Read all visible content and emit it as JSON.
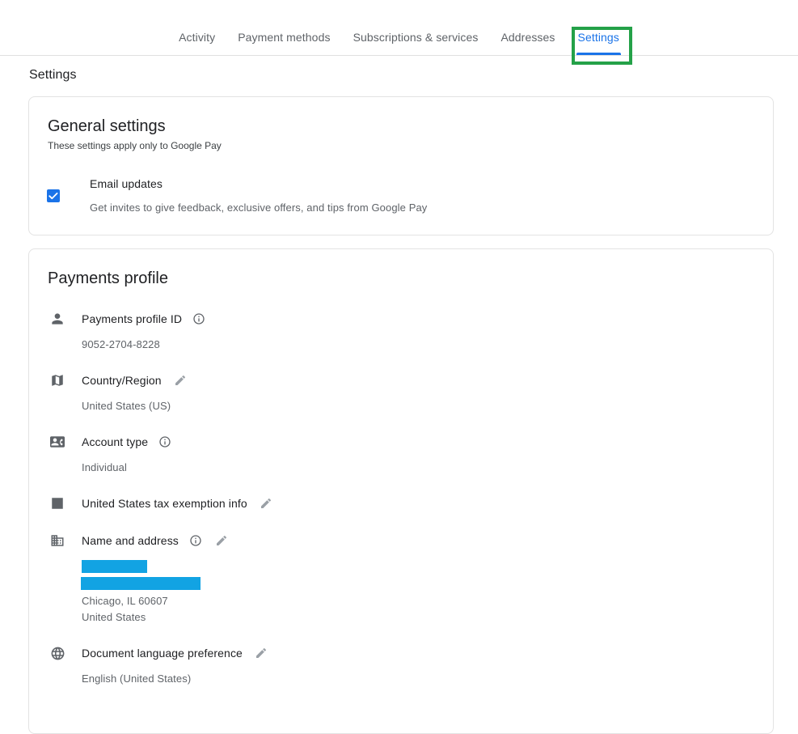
{
  "nav": {
    "tabs": [
      {
        "label": "Activity",
        "active": false
      },
      {
        "label": "Payment methods",
        "active": false
      },
      {
        "label": "Subscriptions & services",
        "active": false
      },
      {
        "label": "Addresses",
        "active": false
      },
      {
        "label": "Settings",
        "active": true
      }
    ],
    "highlight_color": "#24a148",
    "active_color": "#1a73e8"
  },
  "page": {
    "title": "Settings"
  },
  "general_settings": {
    "title": "General settings",
    "subtitle": "These settings apply only to Google Pay",
    "email_updates": {
      "label": "Email updates",
      "description": "Get invites to give feedback, exclusive offers, and tips from Google Pay",
      "checked": true,
      "checkbox_color": "#1a73e8"
    }
  },
  "payments_profile": {
    "title": "Payments profile",
    "rows": [
      {
        "icon": "person-icon",
        "label": "Payments profile ID",
        "info": true,
        "edit": false,
        "value": "9052-2704-8228"
      },
      {
        "icon": "map-icon",
        "label": "Country/Region",
        "info": false,
        "edit": true,
        "value": "United States (US)"
      },
      {
        "icon": "contact-card-icon",
        "label": "Account type",
        "info": true,
        "edit": false,
        "value": "Individual"
      },
      {
        "icon": "list-icon",
        "label": "United States tax exemption info",
        "info": false,
        "edit": true,
        "value": ""
      },
      {
        "icon": "building-icon",
        "label": "Name and address",
        "info": true,
        "edit": true,
        "redacted": true,
        "redact_color": "#12a3e3",
        "address_line_1": "Chicago, IL 60607",
        "address_line_2": "United States"
      },
      {
        "icon": "globe-icon",
        "label": "Document language preference",
        "info": false,
        "edit": true,
        "value": "English (United States)"
      }
    ]
  }
}
